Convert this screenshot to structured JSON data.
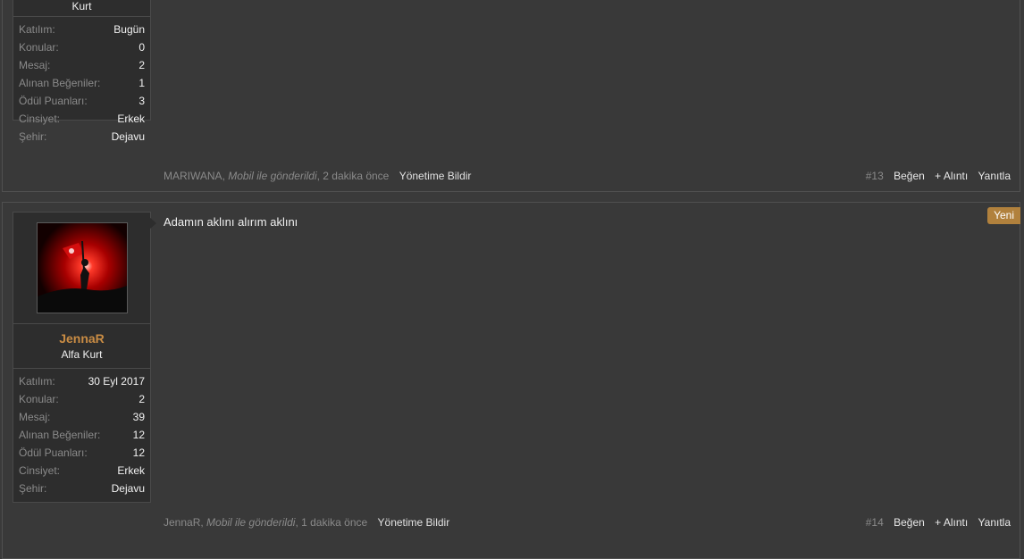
{
  "posts": [
    {
      "user_title": "Kurt",
      "stats": [
        {
          "k": "Katılım:",
          "v": "Bugün"
        },
        {
          "k": "Konular:",
          "v": "0"
        },
        {
          "k": "Mesaj:",
          "v": "2"
        },
        {
          "k": "Alınan Beğeniler:",
          "v": "1"
        },
        {
          "k": "Ödül Puanları:",
          "v": "3"
        },
        {
          "k": "Cinsiyet:",
          "v": "Erkek"
        },
        {
          "k": "Şehir:",
          "v": "Dejavu"
        }
      ],
      "footer": {
        "author": "MARIWANA",
        "via": "Mobil ile gönderildi",
        "time": "2 dakika önce",
        "report": "Yönetime Bildir",
        "number": "#13",
        "like": "Beğen",
        "quote": "+ Alıntı",
        "reply": "Yanıtla"
      }
    },
    {
      "username": "JennaR",
      "user_title": "Alfa Kurt",
      "badge": "Yeni",
      "message": "Adamın aklını alırım aklını",
      "stats": [
        {
          "k": "Katılım:",
          "v": "30 Eyl 2017"
        },
        {
          "k": "Konular:",
          "v": "2"
        },
        {
          "k": "Mesaj:",
          "v": "39"
        },
        {
          "k": "Alınan Beğeniler:",
          "v": "12"
        },
        {
          "k": "Ödül Puanları:",
          "v": "12"
        },
        {
          "k": "Cinsiyet:",
          "v": "Erkek"
        },
        {
          "k": "Şehir:",
          "v": "Dejavu"
        }
      ],
      "footer": {
        "author": "JennaR",
        "via": "Mobil ile gönderildi",
        "time": "1 dakika önce",
        "report": "Yönetime Bildir",
        "number": "#14",
        "like": "Beğen",
        "quote": "+ Alıntı",
        "reply": "Yanıtla"
      }
    }
  ],
  "colors": {
    "background": "#3a3a3a",
    "username": "#c98c44",
    "badge": "#b1813d",
    "muted": "#8a8a8a"
  }
}
